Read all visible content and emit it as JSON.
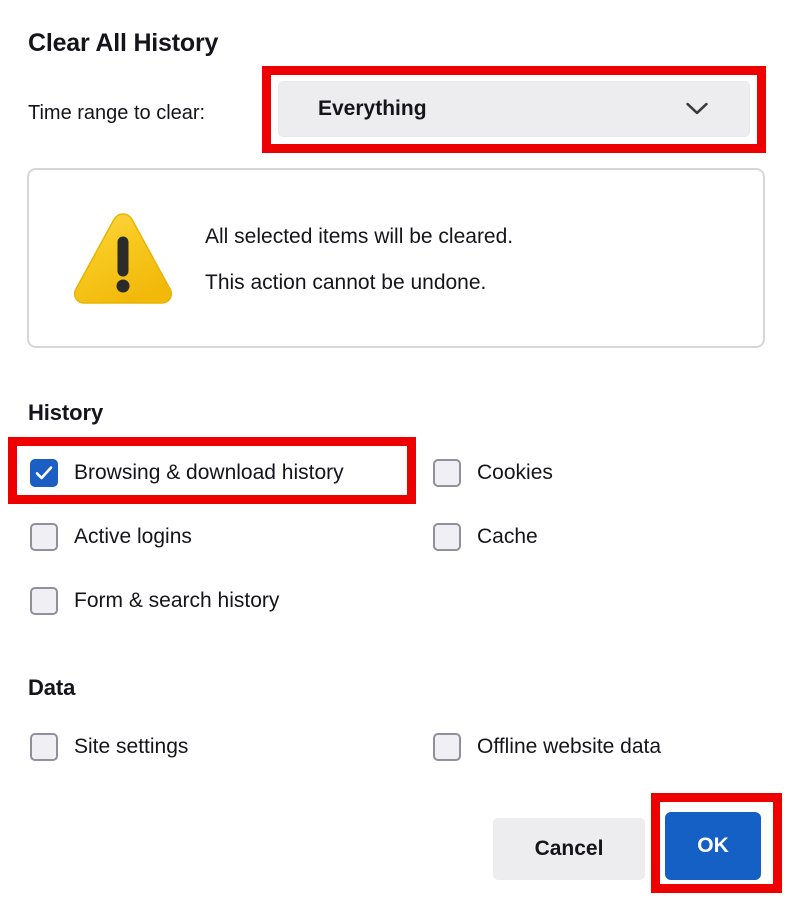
{
  "dialog": {
    "title": "Clear All History",
    "timerange": {
      "label": "Time range to clear:",
      "selected_value": "Everything",
      "chevron_icon": "chevron-down-icon"
    },
    "warning": {
      "icon": "warning-triangle-icon",
      "line1": "All selected items will be cleared.",
      "line2": "This action cannot be undone."
    },
    "sections": [
      {
        "heading": "History",
        "items_left": [
          {
            "label": "Browsing & download history",
            "checked": true
          },
          {
            "label": "Active logins",
            "checked": false
          },
          {
            "label": "Form & search history",
            "checked": false
          }
        ],
        "items_right": [
          {
            "label": "Cookies",
            "checked": false
          },
          {
            "label": "Cache",
            "checked": false
          }
        ]
      },
      {
        "heading": "Data",
        "items_left": [
          {
            "label": "Site settings",
            "checked": false
          }
        ],
        "items_right": [
          {
            "label": "Offline website data",
            "checked": false
          }
        ]
      }
    ],
    "buttons": {
      "cancel": "Cancel",
      "ok": "OK"
    },
    "colors": {
      "accent_blue": "#1560c4",
      "checkbox_checked": "#1b5fc4",
      "annotation_red": "#ee0000",
      "warning_yellow": "#f7c325",
      "control_gray": "#ededf0",
      "text": "#15141a"
    }
  }
}
